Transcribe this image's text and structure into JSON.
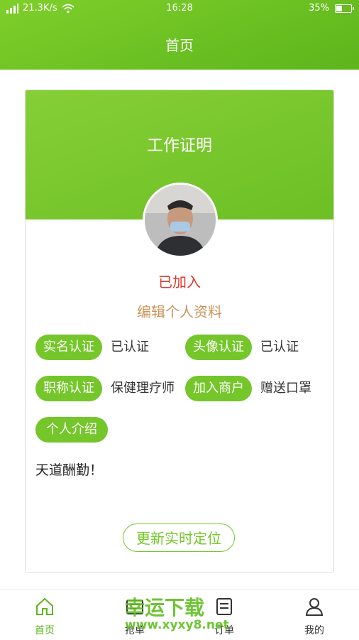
{
  "status_bar": {
    "signal": "4G",
    "speed": "21.3K/s",
    "time": "16:28",
    "battery": "35%",
    "battery_level": 0.35
  },
  "nav": {
    "title": "首页"
  },
  "card": {
    "title": "工作证明",
    "status": "已加入",
    "edit_link": "编辑个人资料",
    "rows": [
      {
        "tag": "实名认证",
        "value": "已认证"
      },
      {
        "tag": "头像认证",
        "value": "已认证"
      },
      {
        "tag": "职称认证",
        "value": "保健理疗师"
      },
      {
        "tag": "加入商户",
        "value": "赠送口罩"
      }
    ],
    "intro_label": "个人介绍",
    "intro_text": "天道酬勤！",
    "location_button": "更新实时定位"
  },
  "tabbar": {
    "items": [
      {
        "label": "首页",
        "icon": "home-icon",
        "active": true
      },
      {
        "label": "抢单",
        "icon": "grab-order-icon",
        "active": false
      },
      {
        "label": "订单",
        "icon": "order-icon",
        "active": false
      },
      {
        "label": "我的",
        "icon": "user-icon",
        "active": false
      }
    ]
  },
  "watermark": {
    "text": "幸运下载",
    "url": "www.xyxy8.net"
  },
  "colors": {
    "accent": "#6cbf25",
    "status_red": "#e03a2f",
    "edit_brown": "#c9945a"
  }
}
